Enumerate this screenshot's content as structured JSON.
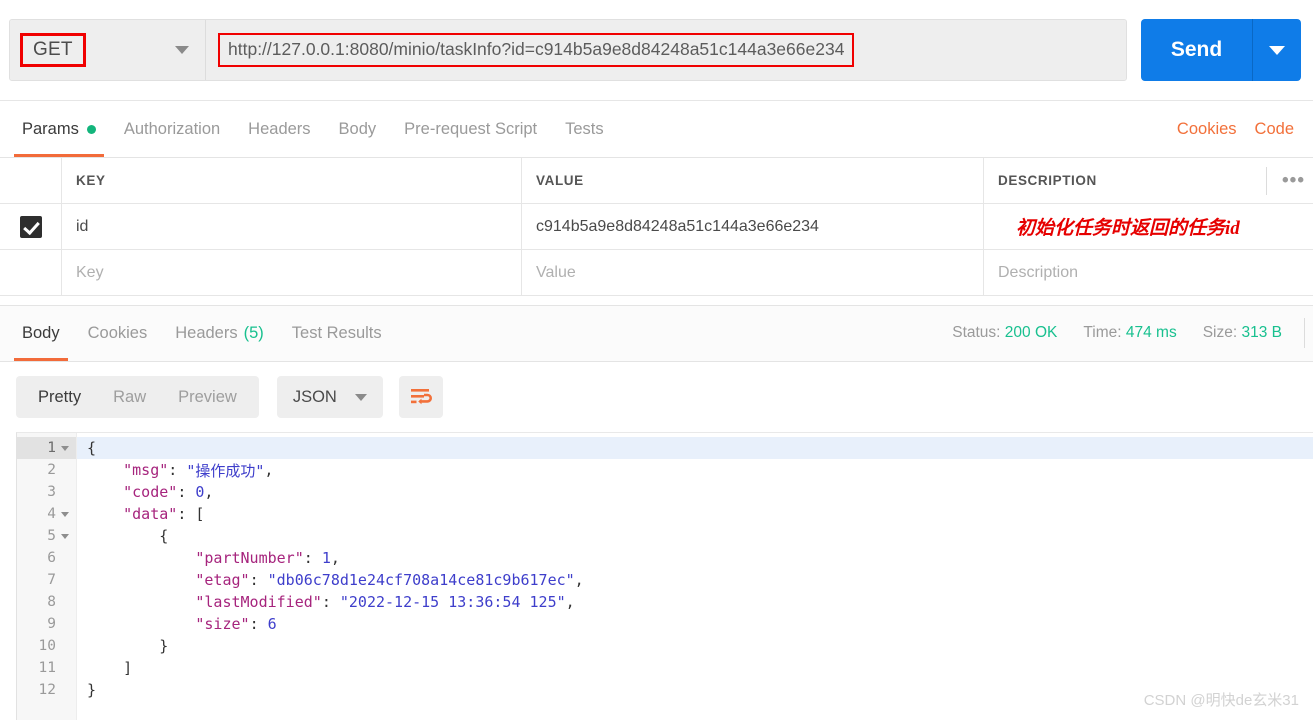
{
  "request": {
    "method": "GET",
    "url": "http://127.0.0.1:8080/minio/taskInfo?id=c914b5a9e8d84248a51c144a3e66e234",
    "send_label": "Send",
    "method_caret": "chevron-down-icon",
    "send_caret": "chevron-down-icon"
  },
  "request_tabs": {
    "items": [
      {
        "label": "Params",
        "active": true,
        "has_dot": true
      },
      {
        "label": "Authorization",
        "active": false,
        "has_dot": false
      },
      {
        "label": "Headers",
        "active": false,
        "has_dot": false
      },
      {
        "label": "Body",
        "active": false,
        "has_dot": false
      },
      {
        "label": "Pre-request Script",
        "active": false,
        "has_dot": false
      },
      {
        "label": "Tests",
        "active": false,
        "has_dot": false
      }
    ],
    "cookies_link": "Cookies",
    "code_link": "Code"
  },
  "params_table": {
    "headers": {
      "key": "KEY",
      "value": "VALUE",
      "description": "DESCRIPTION",
      "more": "•••"
    },
    "rows": [
      {
        "checked": true,
        "key": "id",
        "value": "c914b5a9e8d84248a51c144a3e66e234",
        "description": "",
        "annotation": "初始化任务时返回的任务id"
      },
      {
        "checked": false,
        "key": "",
        "value": "",
        "description": "",
        "key_placeholder": "Key",
        "value_placeholder": "Value",
        "description_placeholder": "Description"
      }
    ]
  },
  "response_tabs": {
    "items": [
      {
        "label": "Body",
        "active": true
      },
      {
        "label": "Cookies",
        "active": false
      },
      {
        "label": "Headers",
        "active": false,
        "count": "(5)"
      },
      {
        "label": "Test Results",
        "active": false
      }
    ],
    "status_label": "Status:",
    "status_value": "200 OK",
    "time_label": "Time:",
    "time_value": "474 ms",
    "size_label": "Size:",
    "size_value": "313 B"
  },
  "body_toolbar": {
    "modes": [
      {
        "label": "Pretty",
        "active": true
      },
      {
        "label": "Raw",
        "active": false
      },
      {
        "label": "Preview",
        "active": false
      }
    ],
    "format": "JSON",
    "format_caret": "chevron-down-icon",
    "wrap_icon": "word-wrap-icon"
  },
  "response_body": {
    "lines": [
      {
        "num": "1",
        "foldable": true,
        "current": true,
        "tokens": [
          {
            "t": "p",
            "v": "{"
          }
        ]
      },
      {
        "num": "2",
        "foldable": false,
        "current": false,
        "tokens": [
          {
            "t": "p",
            "v": "    "
          },
          {
            "t": "k",
            "v": "\"msg\""
          },
          {
            "t": "p",
            "v": ": "
          },
          {
            "t": "s",
            "v": "\"操作成功\""
          },
          {
            "t": "p",
            "v": ","
          }
        ]
      },
      {
        "num": "3",
        "foldable": false,
        "current": false,
        "tokens": [
          {
            "t": "p",
            "v": "    "
          },
          {
            "t": "k",
            "v": "\"code\""
          },
          {
            "t": "p",
            "v": ": "
          },
          {
            "t": "n",
            "v": "0"
          },
          {
            "t": "p",
            "v": ","
          }
        ]
      },
      {
        "num": "4",
        "foldable": true,
        "current": false,
        "tokens": [
          {
            "t": "p",
            "v": "    "
          },
          {
            "t": "k",
            "v": "\"data\""
          },
          {
            "t": "p",
            "v": ": ["
          }
        ]
      },
      {
        "num": "5",
        "foldable": true,
        "current": false,
        "tokens": [
          {
            "t": "p",
            "v": "        {"
          }
        ]
      },
      {
        "num": "6",
        "foldable": false,
        "current": false,
        "tokens": [
          {
            "t": "p",
            "v": "            "
          },
          {
            "t": "k",
            "v": "\"partNumber\""
          },
          {
            "t": "p",
            "v": ": "
          },
          {
            "t": "n",
            "v": "1"
          },
          {
            "t": "p",
            "v": ","
          }
        ]
      },
      {
        "num": "7",
        "foldable": false,
        "current": false,
        "tokens": [
          {
            "t": "p",
            "v": "            "
          },
          {
            "t": "k",
            "v": "\"etag\""
          },
          {
            "t": "p",
            "v": ": "
          },
          {
            "t": "s",
            "v": "\"db06c78d1e24cf708a14ce81c9b617ec\""
          },
          {
            "t": "p",
            "v": ","
          }
        ]
      },
      {
        "num": "8",
        "foldable": false,
        "current": false,
        "tokens": [
          {
            "t": "p",
            "v": "            "
          },
          {
            "t": "k",
            "v": "\"lastModified\""
          },
          {
            "t": "p",
            "v": ": "
          },
          {
            "t": "s",
            "v": "\"2022-12-15 13:36:54 125\""
          },
          {
            "t": "p",
            "v": ","
          }
        ]
      },
      {
        "num": "9",
        "foldable": false,
        "current": false,
        "tokens": [
          {
            "t": "p",
            "v": "            "
          },
          {
            "t": "k",
            "v": "\"size\""
          },
          {
            "t": "p",
            "v": ": "
          },
          {
            "t": "n",
            "v": "6"
          }
        ]
      },
      {
        "num": "10",
        "foldable": false,
        "current": false,
        "tokens": [
          {
            "t": "p",
            "v": "        }"
          }
        ]
      },
      {
        "num": "11",
        "foldable": false,
        "current": false,
        "tokens": [
          {
            "t": "p",
            "v": "    ]"
          }
        ]
      },
      {
        "num": "12",
        "foldable": false,
        "current": false,
        "tokens": [
          {
            "t": "p",
            "v": "}"
          }
        ]
      }
    ]
  },
  "watermark": "CSDN @明快de玄米31",
  "colors": {
    "accent_orange": "#f26b3a",
    "send_blue": "#0f7ce8",
    "status_green": "#18c08f",
    "annotation_red": "#e60000",
    "highlight_red": "#f00000"
  }
}
